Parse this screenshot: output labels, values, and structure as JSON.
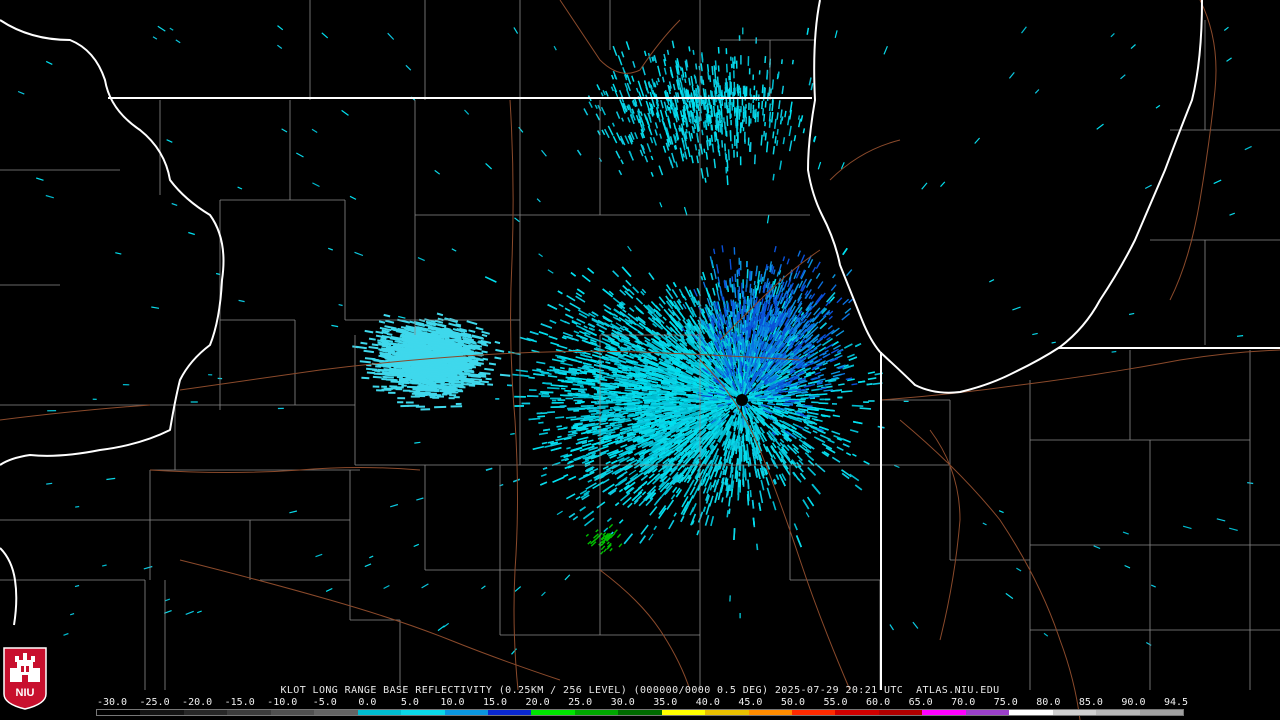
{
  "caption": "KLOT LONG RANGE BASE REFLECTIVITY (0.25KM / 256 LEVEL) (000000/0000 0.5 DEG) 2025-07-29 20:21 UTC  ATLAS.NIU.EDU",
  "logo": {
    "text": "NIU",
    "icon": "university-tower-logo",
    "colors": {
      "background": "#c8102e",
      "foreground": "#ffffff"
    }
  },
  "colors": {
    "background": "#000000",
    "state_borders": "#ffffff",
    "county_borders": "#8a8a8a",
    "highways": "#8b4a2b",
    "radar_site": "#000000"
  },
  "scale": {
    "labels": [
      "-30.0",
      "-25.0",
      "-20.0",
      "-15.0",
      "-10.0",
      "-5.0",
      "0.0",
      "5.0",
      "10.0",
      "15.0",
      "20.0",
      "25.0",
      "30.0",
      "35.0",
      "40.0",
      "45.0",
      "50.0",
      "55.0",
      "60.0",
      "65.0",
      "70.0",
      "75.0",
      "80.0",
      "85.0",
      "90.0",
      "94.5"
    ],
    "colors": [
      "#000000",
      "#141414",
      "#282828",
      "#3c3c3c",
      "#505050",
      "#646464",
      "#00bcd0",
      "#0ad8e8",
      "#0a96e0",
      "#0a28d0",
      "#00e400",
      "#00a800",
      "#006a00",
      "#ffff00",
      "#e8c000",
      "#ff8c00",
      "#ff2a00",
      "#d00000",
      "#b00000",
      "#ff00ff",
      "#9a40c8",
      "#ffffff",
      "#d0d0d0",
      "#b8b8b8",
      "#a0a0a0"
    ]
  }
}
